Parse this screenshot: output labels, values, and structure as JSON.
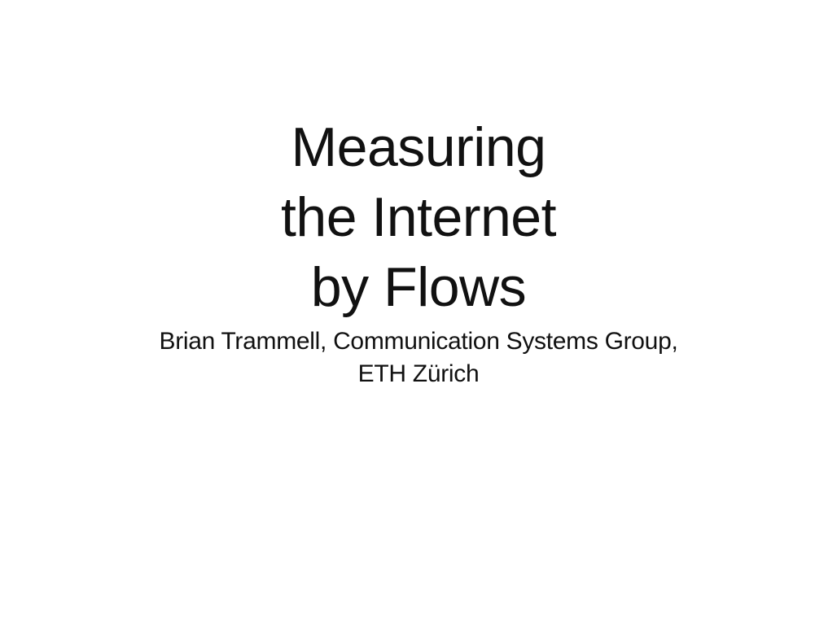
{
  "slide": {
    "title_lines": [
      "Measuring",
      "the Internet",
      "by Flows"
    ],
    "subtitle_lines": [
      "Brian Trammell, Communication Systems Group,",
      "ETH Zürich"
    ]
  },
  "colors": {
    "background": "#ffffff",
    "text": "#111111"
  }
}
